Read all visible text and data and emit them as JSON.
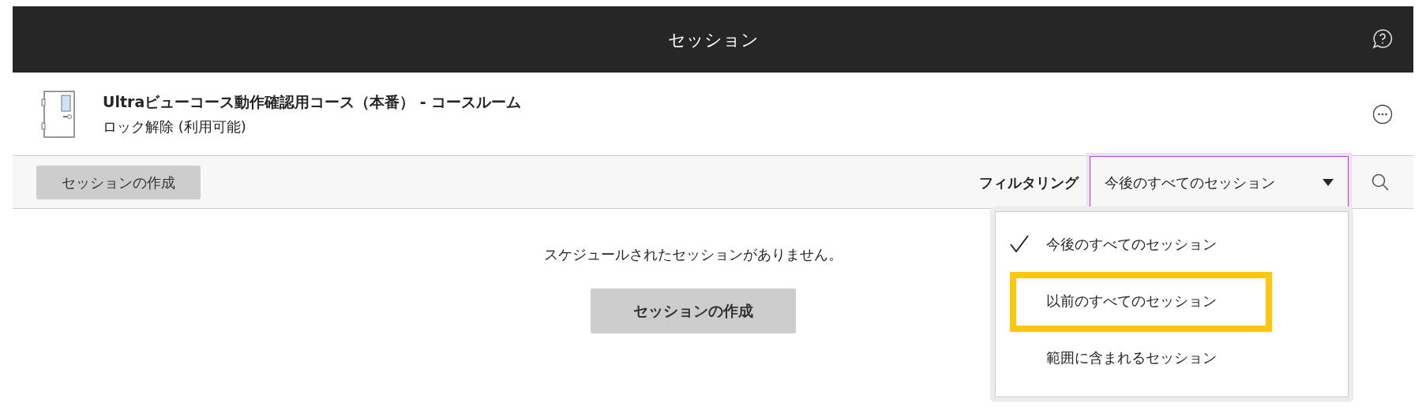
{
  "header": {
    "title": "セッション"
  },
  "course": {
    "title": "Ultraビューコース動作確認用コース（本番） - コースルーム",
    "status": "ロック解除 (利用可能)"
  },
  "toolbar": {
    "create_button": "セッションの作成",
    "filter_label": "フィルタリング",
    "filter_value": "今後のすべてのセッション",
    "expanded": true
  },
  "filter_menu": [
    {
      "label": "今後のすべてのセッション",
      "selected": true,
      "highlighted": false
    },
    {
      "label": "以前のすべてのセッション",
      "selected": false,
      "highlighted": true
    },
    {
      "label": "範囲に含まれるセッション",
      "selected": false,
      "highlighted": false
    }
  ],
  "empty": {
    "message": "スケジュールされたセッションがありません。",
    "button": "セッションの作成"
  }
}
